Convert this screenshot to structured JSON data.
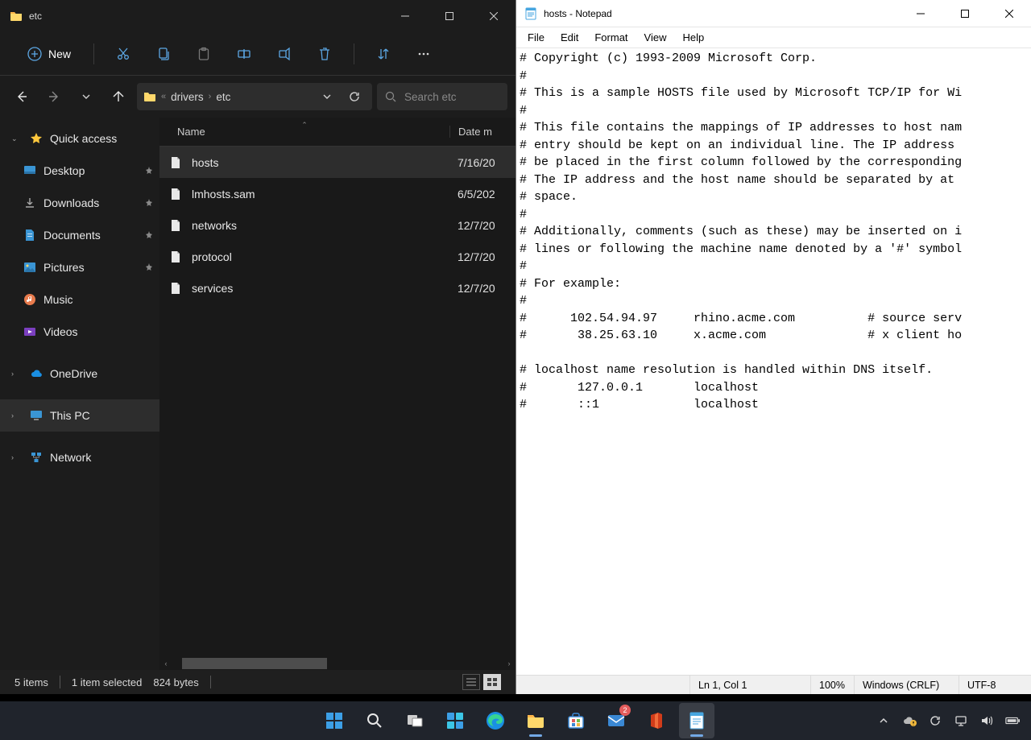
{
  "explorer": {
    "title": "etc",
    "toolbar": {
      "new_label": "New"
    },
    "breadcrumb": {
      "segments": [
        "drivers",
        "etc"
      ]
    },
    "search_placeholder": "Search etc",
    "sidebar": {
      "quick_access": {
        "label": "Quick access"
      },
      "items": [
        {
          "label": "Desktop",
          "pinned": true
        },
        {
          "label": "Downloads",
          "pinned": true
        },
        {
          "label": "Documents",
          "pinned": true
        },
        {
          "label": "Pictures",
          "pinned": true
        },
        {
          "label": "Music",
          "pinned": false
        },
        {
          "label": "Videos",
          "pinned": false
        }
      ],
      "onedrive": {
        "label": "OneDrive"
      },
      "this_pc": {
        "label": "This PC"
      },
      "network": {
        "label": "Network"
      }
    },
    "columns": {
      "name": "Name",
      "date": "Date m"
    },
    "files": [
      {
        "name": "hosts",
        "date": "7/16/20"
      },
      {
        "name": "lmhosts.sam",
        "date": "6/5/202"
      },
      {
        "name": "networks",
        "date": "12/7/20"
      },
      {
        "name": "protocol",
        "date": "12/7/20"
      },
      {
        "name": "services",
        "date": "12/7/20"
      }
    ],
    "status": {
      "count": "5 items",
      "selected": "1 item selected",
      "size": "824 bytes"
    }
  },
  "notepad": {
    "title": "hosts - Notepad",
    "menu": [
      "File",
      "Edit",
      "Format",
      "View",
      "Help"
    ],
    "content": "# Copyright (c) 1993-2009 Microsoft Corp.\n#\n# This is a sample HOSTS file used by Microsoft TCP/IP for Wi\n#\n# This file contains the mappings of IP addresses to host nam\n# entry should be kept on an individual line. The IP address \n# be placed in the first column followed by the corresponding\n# The IP address and the host name should be separated by at \n# space.\n#\n# Additionally, comments (such as these) may be inserted on i\n# lines or following the machine name denoted by a '#' symbol\n#\n# For example:\n#\n#      102.54.94.97     rhino.acme.com          # source serv\n#       38.25.63.10     x.acme.com              # x client ho\n\n# localhost name resolution is handled within DNS itself.\n#       127.0.0.1       localhost\n#       ::1             localhost",
    "status": {
      "line_col": "Ln 1, Col 1",
      "zoom": "100%",
      "eol": "Windows (CRLF)",
      "enc": "UTF-8"
    }
  },
  "taskbar": {
    "mail_badge": "2"
  }
}
